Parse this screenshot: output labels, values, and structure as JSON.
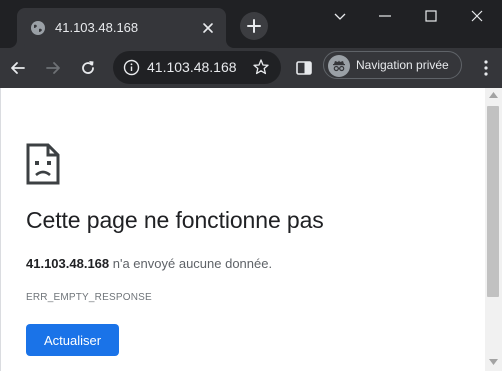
{
  "tab": {
    "title": "41.103.48.168",
    "favicon": "globe-icon",
    "close_icon": "close-icon"
  },
  "window_controls": [
    "chevron-down-icon",
    "minimize-icon",
    "maximize-icon",
    "close-icon"
  ],
  "toolbar": {
    "url": "41.103.48.168",
    "incognito_label": "Navigation privée"
  },
  "page": {
    "title": "Cette page ne fonctionne pas",
    "host": "41.103.48.168",
    "description_suffix": " n'a envoyé aucune donnée.",
    "error_code": "ERR_EMPTY_RESPONSE",
    "reload_label": "Actualiser"
  },
  "colors": {
    "chrome_dark": "#202124",
    "toolbar": "#35363a",
    "accent_button": "#1a73e8",
    "page_bg": "#ffffff"
  }
}
